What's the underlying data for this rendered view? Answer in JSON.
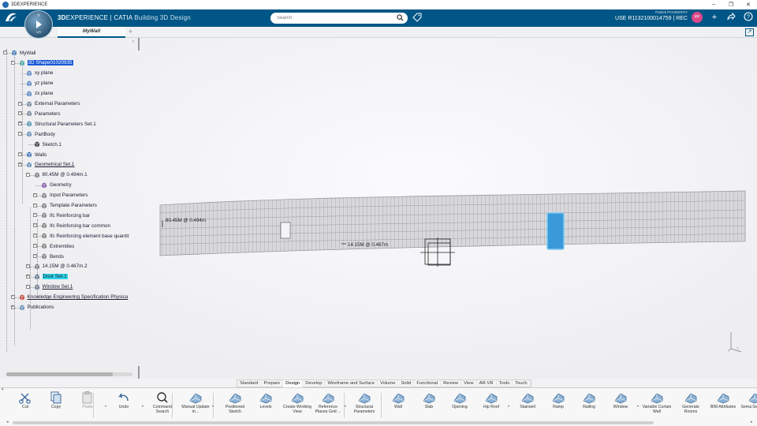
{
  "window": {
    "title": "3DEXPERIENCE",
    "minimize": "–",
    "restore": "❐",
    "close": "✕"
  },
  "header": {
    "brand_prefix": "3D",
    "brand_main": "EXPERIENCE | CATIA",
    "app_name": "Building 3D Design",
    "compass_top": "V",
    "compass_bottom": "V,R",
    "search_placeholder": "Search",
    "user_name": "Patrick POUDEROY",
    "context": "USE R1132100014759 | REC",
    "avatar_initials": "PP",
    "icons": {
      "search": "search-icon",
      "tag": "tag-icon",
      "add": "plus-icon",
      "share": "share-icon",
      "help": "help-icon"
    }
  },
  "tabs": {
    "active": "MyWall",
    "add": "+"
  },
  "tree": {
    "root": "MyWall",
    "items": [
      {
        "label": "3D Shape01020935",
        "style": "selected"
      },
      {
        "label": "xy plane"
      },
      {
        "label": "yz plane"
      },
      {
        "label": "zx plane"
      },
      {
        "label": "External Parameters"
      },
      {
        "label": "Parameters"
      },
      {
        "label": "Structural Parameters Set.1"
      },
      {
        "label": "PartBody"
      },
      {
        "label": "Sketch.1"
      },
      {
        "label": "Walls"
      },
      {
        "label": "Geometrical Set.1",
        "style": "underline"
      },
      {
        "label": "80.45M @ 0.494m.1"
      },
      {
        "label": "Geometry"
      },
      {
        "label": "Input Parameters"
      },
      {
        "label": "Template Parameters"
      },
      {
        "label": "Ifc Reinforcing bar"
      },
      {
        "label": "Ifc Reinforcing bar common"
      },
      {
        "label": "Ifc Reinforcing element base quantit"
      },
      {
        "label": "Extremities"
      },
      {
        "label": "Bends"
      },
      {
        "label": "14.15M @ 0.467m.2"
      },
      {
        "label": "Door Set.1",
        "style": "highlight"
      },
      {
        "label": "Window Set.1",
        "style": "underline"
      },
      {
        "label": "Knowledge Engineering Specification Physica",
        "style": "underline"
      },
      {
        "label": "Publications"
      }
    ]
  },
  "viewport": {
    "wall_label_1": "80.45M @ 0.494m",
    "wall_label_2": "14.15M @ 0.467m"
  },
  "ribbon_tabs": [
    "Standard",
    "Prepare",
    "Design",
    "Develop",
    "Wireframe and Surface",
    "Volume",
    "Solid",
    "Functional",
    "Review",
    "View",
    "AR-VR",
    "Tools",
    "Touch"
  ],
  "ribbon_active": "Design",
  "actions": [
    {
      "label": "Cut",
      "icon": "cut-icon",
      "enabled": true
    },
    {
      "label": "Copy",
      "icon": "copy-icon",
      "enabled": true
    },
    {
      "label": "Paste",
      "icon": "paste-icon",
      "enabled": false
    },
    {
      "label": "Undo",
      "icon": "undo-icon",
      "enabled": true
    },
    {
      "label": "Command Search",
      "icon": "command-search-icon",
      "enabled": true
    },
    {
      "label": "Manual Update m...",
      "icon": "manual-update-icon",
      "enabled": true
    },
    {
      "label": "Positioned Sketch",
      "icon": "positioned-sketch-icon",
      "enabled": true
    },
    {
      "label": "Levels",
      "icon": "levels-icon",
      "enabled": true
    },
    {
      "label": "Create Working View",
      "icon": "working-view-icon",
      "enabled": true
    },
    {
      "label": "Reference Planes Grid ...",
      "icon": "planes-grid-icon",
      "enabled": true
    },
    {
      "label": "Structural Parameters",
      "icon": "structural-parameters-icon",
      "enabled": true
    },
    {
      "label": "Wall",
      "icon": "wall-icon",
      "enabled": true
    },
    {
      "label": "Slab",
      "icon": "slab-icon",
      "enabled": true
    },
    {
      "label": "Opening",
      "icon": "opening-icon",
      "enabled": true
    },
    {
      "label": "Hip Roof",
      "icon": "hip-roof-icon",
      "enabled": true
    },
    {
      "label": "Stairwell",
      "icon": "stairwell-icon",
      "enabled": true
    },
    {
      "label": "Ramp",
      "icon": "ramp-icon",
      "enabled": true
    },
    {
      "label": "Railing",
      "icon": "railing-icon",
      "enabled": true
    },
    {
      "label": "Window",
      "icon": "window-icon",
      "enabled": true
    },
    {
      "label": "Variable Curtain Wall",
      "icon": "curtain-wall-icon",
      "enabled": true
    },
    {
      "label": "Generate Rooms",
      "icon": "generate-rooms-icon",
      "enabled": true
    },
    {
      "label": "BIM Attributes",
      "icon": "bim-attributes-icon",
      "enabled": true
    },
    {
      "label": "Sema Geometr",
      "icon": "semantic-geometry-icon",
      "enabled": true
    }
  ],
  "colors": {
    "header": "#005686",
    "selection": "#1858d6",
    "highlight": "#2fd4e8",
    "accent_blue": "#3a9ad9"
  }
}
